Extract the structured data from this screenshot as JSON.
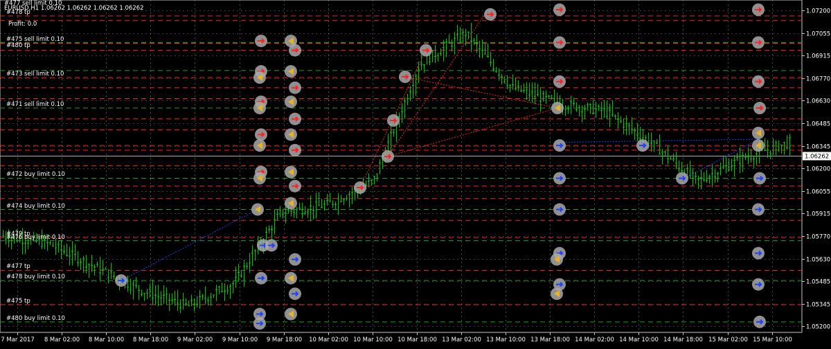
{
  "header": {
    "cut_label": "#477 sell limit 0.10",
    "symbol_line": "EURUSD,H1  1.06262 1.06262 1.06262 1.06262",
    "profit": "Profit: 0.0"
  },
  "colors": {
    "background": "#000000",
    "grid": "#c8c8c8",
    "candle": "#00c800",
    "sell_line": "#ff2020",
    "buy_line": "#2040ff",
    "green_line": "#22a022",
    "bid_line": "#b4b4b4",
    "marker": "#a9a9a9",
    "arrow_sell": "#ff2020",
    "arrow_buy": "#2040ff",
    "arrow_hist": "#e6b422"
  },
  "price_axis": {
    "min": 1.0518,
    "max": 1.0728,
    "labels": [
      "1.07200",
      "1.07055",
      "1.06915",
      "1.06770",
      "1.06630",
      "1.06485",
      "1.06345",
      "1.06200",
      "1.06055",
      "1.05915",
      "1.05770",
      "1.05630",
      "1.05485",
      "1.05345",
      "1.05200"
    ],
    "current": "1.06262"
  },
  "time_axis": {
    "labels": [
      "7 Mar 2017",
      "8 Mar 02:00",
      "8 Mar 10:00",
      "8 Mar 18:00",
      "9 Mar 02:00",
      "9 Mar 10:00",
      "9 Mar 18:00",
      "10 Mar 02:00",
      "10 Mar 10:00",
      "10 Mar 18:00",
      "13 Mar 02:00",
      "13 Mar 10:00",
      "13 Mar 18:00",
      "14 Mar 02:00",
      "14 Mar 10:00",
      "14 Mar 18:00",
      "15 Mar 02:00",
      "15 Mar 10:00"
    ]
  },
  "order_labels": [
    {
      "text": "#478 tp",
      "price": 1.0716,
      "kind": "green"
    },
    {
      "text": "#475 sell limit 0.10",
      "price": 1.06985,
      "kind": "red"
    },
    {
      "text": "#480 tp",
      "price": 1.06945,
      "kind": "green"
    },
    {
      "text": "#473 sell limit 0.10",
      "price": 1.06765,
      "kind": "red"
    },
    {
      "text": "#471 sell limit 0.10",
      "price": 1.0657,
      "kind": "red"
    },
    {
      "text": "#472 buy limit 0.10",
      "price": 1.0612,
      "kind": "green"
    },
    {
      "text": "#474 buy limit 0.10",
      "price": 1.0592,
      "kind": "green"
    },
    {
      "text": "#479 tp",
      "price": 1.0574,
      "kind": "red"
    },
    {
      "text": "#476 buy limit 0.10",
      "price": 1.0572,
      "kind": "green"
    },
    {
      "text": "#477 tp",
      "price": 1.0553,
      "kind": "red"
    },
    {
      "text": "#478 buy limit 0.10",
      "price": 1.05465,
      "kind": "green"
    },
    {
      "text": "#475 tp",
      "price": 1.0531,
      "kind": "red"
    },
    {
      "text": "#480 buy limit 0.10",
      "price": 1.052,
      "kind": "green"
    }
  ],
  "chart_data": {
    "type": "line",
    "title": "",
    "xlabel": "",
    "ylabel": "",
    "symbol": "EURUSD",
    "timeframe": "H1",
    "grid": true,
    "ylim": [
      1.0518,
      1.0728
    ],
    "x": [
      "7 Mar 2017",
      "8 Mar 02:00",
      "8 Mar 10:00",
      "8 Mar 18:00",
      "9 Mar 02:00",
      "9 Mar 10:00",
      "9 Mar 18:00",
      "10 Mar 02:00",
      "10 Mar 10:00",
      "10 Mar 18:00",
      "13 Mar 02:00",
      "13 Mar 10:00",
      "13 Mar 18:00",
      "14 Mar 02:00",
      "14 Mar 10:00",
      "14 Mar 18:00",
      "15 Mar 02:00",
      "15 Mar 10:00"
    ],
    "series": [
      {
        "values": [
          1.0575,
          1.057,
          1.0555,
          1.054,
          1.053,
          1.0545,
          1.059,
          1.0595,
          1.061,
          1.0685,
          1.0705,
          1.067,
          1.066,
          1.0655,
          1.0635,
          1.061,
          1.0625,
          1.0635
        ]
      }
    ],
    "horizontal_lines": [
      {
        "price": 1.0716,
        "kind": "red"
      },
      {
        "price": 1.0713,
        "kind": "red"
      },
      {
        "price": 1.0699,
        "kind": "green"
      },
      {
        "price": 1.06985,
        "kind": "red"
      },
      {
        "price": 1.0694,
        "kind": "red"
      },
      {
        "price": 1.0681,
        "kind": "green"
      },
      {
        "price": 1.06765,
        "kind": "red"
      },
      {
        "price": 1.067,
        "kind": "red"
      },
      {
        "price": 1.0663,
        "kind": "red"
      },
      {
        "price": 1.0657,
        "kind": "green"
      },
      {
        "price": 1.065,
        "kind": "red"
      },
      {
        "price": 1.0643,
        "kind": "red"
      },
      {
        "price": 1.0633,
        "kind": "red"
      },
      {
        "price": 1.063,
        "kind": "red"
      },
      {
        "price": 1.062,
        "kind": "red"
      },
      {
        "price": 1.0612,
        "kind": "green"
      },
      {
        "price": 1.0607,
        "kind": "red"
      },
      {
        "price": 1.0599,
        "kind": "red"
      },
      {
        "price": 1.0592,
        "kind": "green"
      },
      {
        "price": 1.0585,
        "kind": "red"
      },
      {
        "price": 1.0574,
        "kind": "red"
      },
      {
        "price": 1.0572,
        "kind": "green"
      },
      {
        "price": 1.0553,
        "kind": "red"
      },
      {
        "price": 1.05465,
        "kind": "green"
      },
      {
        "price": 1.0531,
        "kind": "red"
      },
      {
        "price": 1.052,
        "kind": "green"
      }
    ]
  }
}
